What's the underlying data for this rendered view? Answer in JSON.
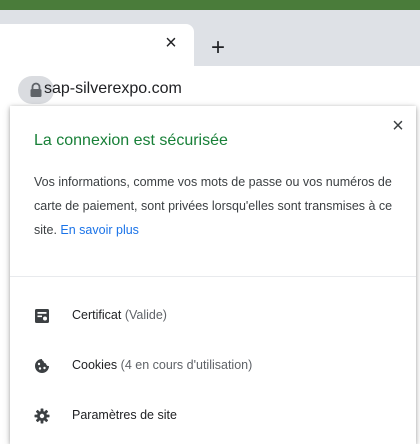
{
  "browser": {
    "tab_close_glyph": "×",
    "new_tab_glyph": "+",
    "url": "sap-silverexpo.com"
  },
  "site_info": {
    "close_glyph": "×",
    "title": "La connexion est sécurisée",
    "description": "Vos informations, comme vos mots de passe ou vos numéros de carte de paiement, sont privées lorsqu'elles sont transmises à ce site.",
    "learn_more": "En savoir plus",
    "items": [
      {
        "label": "Certificat",
        "detail": "(Valide)",
        "icon": "certificate-icon"
      },
      {
        "label": "Cookies",
        "detail": "(4 en cours d'utilisation)",
        "icon": "cookie-icon"
      },
      {
        "label": "Paramètres de site",
        "detail": "",
        "icon": "gear-icon"
      }
    ]
  },
  "colors": {
    "title_green": "#188038",
    "link_blue": "#1a73e8",
    "tabstrip": "#dee1e6",
    "top_accent": "#4a7c3a"
  }
}
